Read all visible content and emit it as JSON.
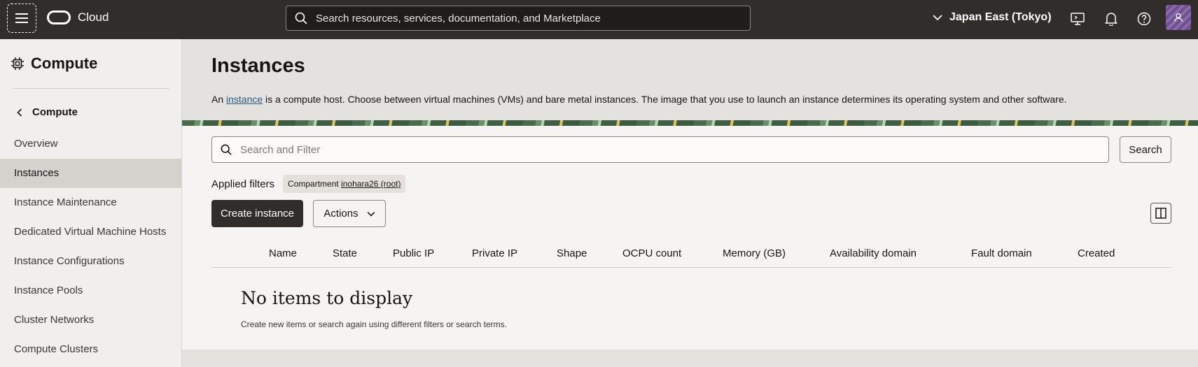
{
  "topbar": {
    "brand": "Cloud",
    "search_placeholder": "Search resources, services, documentation, and Marketplace",
    "region": "Japan East (Tokyo)"
  },
  "sidebar": {
    "title": "Compute",
    "back_label": "Compute",
    "items": [
      {
        "label": "Overview"
      },
      {
        "label": "Instances",
        "active": true
      },
      {
        "label": "Instance Maintenance"
      },
      {
        "label": "Dedicated Virtual Machine Hosts"
      },
      {
        "label": "Instance Configurations"
      },
      {
        "label": "Instance Pools"
      },
      {
        "label": "Cluster Networks"
      },
      {
        "label": "Compute Clusters"
      }
    ]
  },
  "main": {
    "title": "Instances",
    "desc_prefix": "An ",
    "desc_link": "instance",
    "desc_suffix": " is a compute host. Choose between virtual machines (VMs) and bare metal instances. The image that you use to launch an instance determines its operating system and other software.",
    "filter_placeholder": "Search and Filter",
    "search_button": "Search",
    "applied_filters_label": "Applied filters",
    "chip_label": "Compartment ",
    "chip_value": "inohara26 (root)",
    "create_button": "Create instance",
    "actions_button": "Actions",
    "columns": [
      "Name",
      "State",
      "Public IP",
      "Private IP",
      "Shape",
      "OCPU count",
      "Memory (GB)",
      "Availability domain",
      "Fault domain",
      "Created"
    ],
    "empty_title": "No items to display",
    "empty_subtitle": "Create new items or search again using different filters or search terms."
  }
}
